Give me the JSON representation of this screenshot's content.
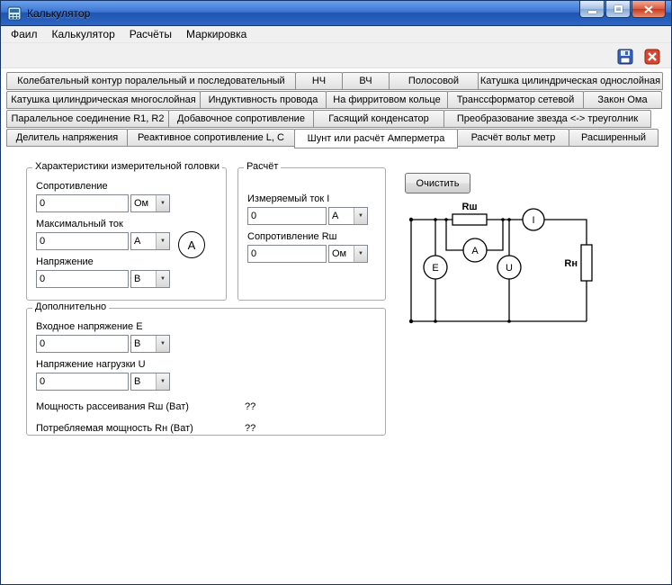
{
  "window": {
    "title": "Калькулятор"
  },
  "menu": {
    "items": [
      "Фаил",
      "Калькулятор",
      "Расчёты",
      "Маркировка"
    ]
  },
  "toolbar": {
    "icons": [
      "save-icon",
      "close-icon"
    ]
  },
  "tabs": {
    "active": "Шунт или расчёт Амперметра",
    "row1": [
      "Колебательный контур поралельный и последовательный",
      "НЧ",
      "ВЧ",
      "Полосовой",
      "Катушка цилиндрическая однослойная"
    ],
    "row2": [
      "Катушка цилиндрическая многослойная",
      "Индуктивность провода",
      "На фирритовом кольце",
      "Транссформатор сетевой",
      "Закон Ома"
    ],
    "row3": [
      "Паралельное соединение R1, R2",
      "Добавочное сопротивление",
      "Гасящий конденсатор",
      "Преобразование звезда <-> треуголник"
    ],
    "row4": [
      "Делитель напряжения",
      "Реактивное сопротивление L, C",
      "Шунт или расчёт Амперметра",
      "Расчёт вольт метр",
      "Расширенный"
    ]
  },
  "head_group": {
    "legend": "Характеристики измерительной головки",
    "meter_symbol": "А",
    "fields": [
      {
        "label": "Сопротивление",
        "value": "0",
        "unit": "Ом"
      },
      {
        "label": "Максимальный ток",
        "value": "0",
        "unit": "А"
      },
      {
        "label": "Напряжение",
        "value": "0",
        "unit": "В"
      }
    ]
  },
  "calc_group": {
    "legend": "Расчёт",
    "fields": [
      {
        "label": "Измеряемый ток I",
        "value": "0",
        "unit": "А"
      },
      {
        "label": "Сопротивление Rш",
        "value": "0",
        "unit": "Ом"
      }
    ]
  },
  "clear_button": "Очистить",
  "extra_group": {
    "legend": "Дополнительно",
    "fields": [
      {
        "label": "Входное напряжение E",
        "value": "0",
        "unit": "В"
      },
      {
        "label": "Напряжение нагрузки U",
        "value": "0",
        "unit": "В"
      }
    ],
    "outputs": [
      {
        "label": "Мощность рассеивания Rш (Ват)",
        "value": "??"
      },
      {
        "label": "Потребляемая мощность Rн (Ват)",
        "value": "??"
      }
    ]
  },
  "circuit": {
    "labels": {
      "shunt": "Rш",
      "current_meter": "I",
      "head_meter": "А",
      "source": "E",
      "voltmeter": "U",
      "load": "Rн"
    }
  },
  "colors": {
    "titlebar_blue": "#2e66c4",
    "close_red": "#c23a20",
    "save_blue": "#3a63c8"
  }
}
